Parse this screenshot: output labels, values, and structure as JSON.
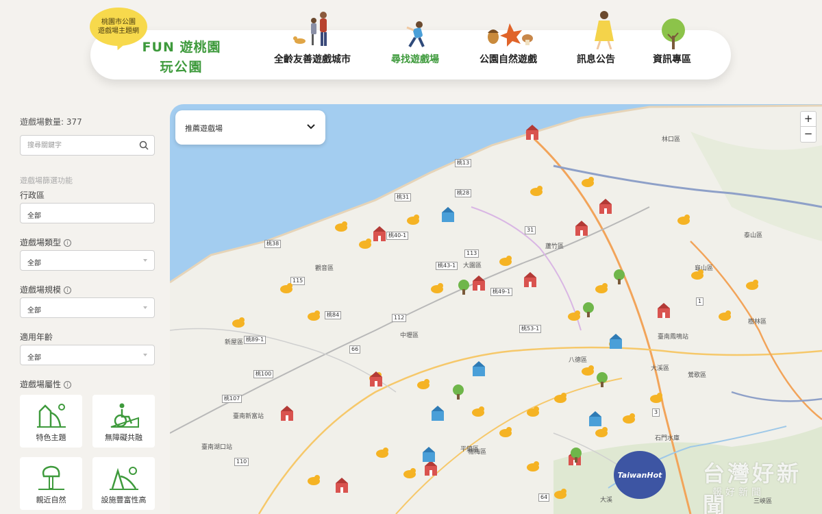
{
  "header": {
    "bubble_line1": "桃園市公園",
    "bubble_line2": "遊戲場主題網",
    "logo_line1": "FUN 遊桃園",
    "logo_line2": "玩公園",
    "nav": [
      {
        "label": "全齡友善遊戲城市",
        "active": false
      },
      {
        "label": "尋找遊戲場",
        "active": true
      },
      {
        "label": "公園自然遊戲",
        "active": false
      },
      {
        "label": "訊息公告",
        "active": false
      },
      {
        "label": "資訊專區",
        "active": false
      }
    ]
  },
  "sidebar": {
    "count_label": "遊戲場數量: 377",
    "search_placeholder": "搜尋關鍵字",
    "filter_title": "遊戲場篩選功能",
    "filters": [
      {
        "label": "行政區",
        "value": "全部",
        "info": false
      },
      {
        "label": "遊戲場類型",
        "value": "全部",
        "info": true
      },
      {
        "label": "遊戲場規模",
        "value": "全部",
        "info": true
      },
      {
        "label": "適用年齡",
        "value": "全部",
        "info": false
      }
    ],
    "attr_title": "遊戲場屬性",
    "attributes": [
      {
        "label": "特色主題",
        "icon": "slide-icon"
      },
      {
        "label": "無障礙共融",
        "icon": "wheelchair-icon"
      },
      {
        "label": "親近自然",
        "icon": "tree-icon"
      },
      {
        "label": "設施豐富性高",
        "icon": "playground-icon"
      }
    ]
  },
  "map": {
    "dropdown_label": "推薦遊戲場",
    "zoom_in": "+",
    "zoom_out": "−",
    "district_labels": [
      "大園區",
      "蘆竹區",
      "觀音區",
      "新屋區",
      "中壢區",
      "八德區",
      "大溪區",
      "龜山區",
      "樹林區",
      "鶯歌區",
      "新屋區",
      "楊梅區",
      "平鎮區",
      "臺南新富站",
      "臺南鳳鳴站",
      "臺南湖口站",
      "林口區",
      "泰山區",
      "三峽區",
      "石門水庫",
      "大溪"
    ],
    "road_labels": [
      "桃13",
      "桃28",
      "桃31",
      "桃38",
      "桃40-1",
      "桃43-1",
      "桃49-1",
      "桃53-1",
      "桃84",
      "桃89-1",
      "桃100",
      "桃107",
      "115",
      "113",
      "112",
      "110",
      "31",
      "1",
      "66",
      "3",
      "64"
    ],
    "watermark_logo": "TaiwanHot",
    "watermark_text": "台灣好新聞",
    "watermark_sub": "報好新聞"
  },
  "colors": {
    "brand_green": "#3e9a3c",
    "bubble_yellow": "#f7d94c",
    "sea": "#a3cdf0",
    "pin_yellow": "#f5b324",
    "pin_red": "#d9534f",
    "pin_blue": "#4a9fd8"
  }
}
